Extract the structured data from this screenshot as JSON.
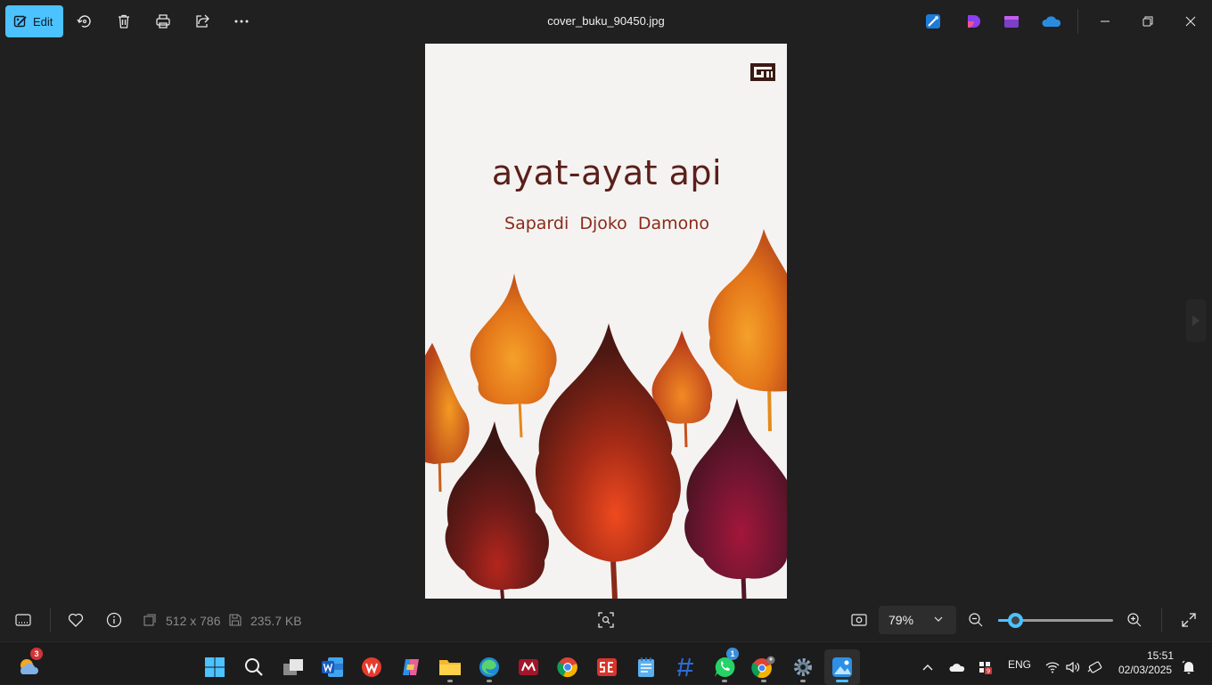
{
  "titlebar": {
    "edit_label": "Edit",
    "filename": "cover_buku_90450.jpg",
    "tools": [
      "rotate-icon",
      "delete-icon",
      "print-icon",
      "share-icon",
      "more-icon"
    ],
    "apps": [
      "designer-icon",
      "clipchamp-icon",
      "video-editor-icon",
      "onedrive-icon"
    ]
  },
  "cover": {
    "publisher_mark": "GM",
    "title": "ayat-ayat api",
    "author": "Sapardi  Djoko  Damono"
  },
  "bottombar": {
    "dimensions": "512 x 786",
    "file_size": "235.7 KB",
    "zoom": "79%",
    "zoom_level": 0.15
  },
  "taskbar": {
    "weather_badge": "3",
    "whatsapp_badge": "1",
    "lang": "ENG",
    "time": "15:51",
    "date": "02/03/2025"
  },
  "colors": {
    "accent": "#4cc2ff",
    "title_text": "#5a1f1a",
    "author_text": "#8a2a1a"
  }
}
